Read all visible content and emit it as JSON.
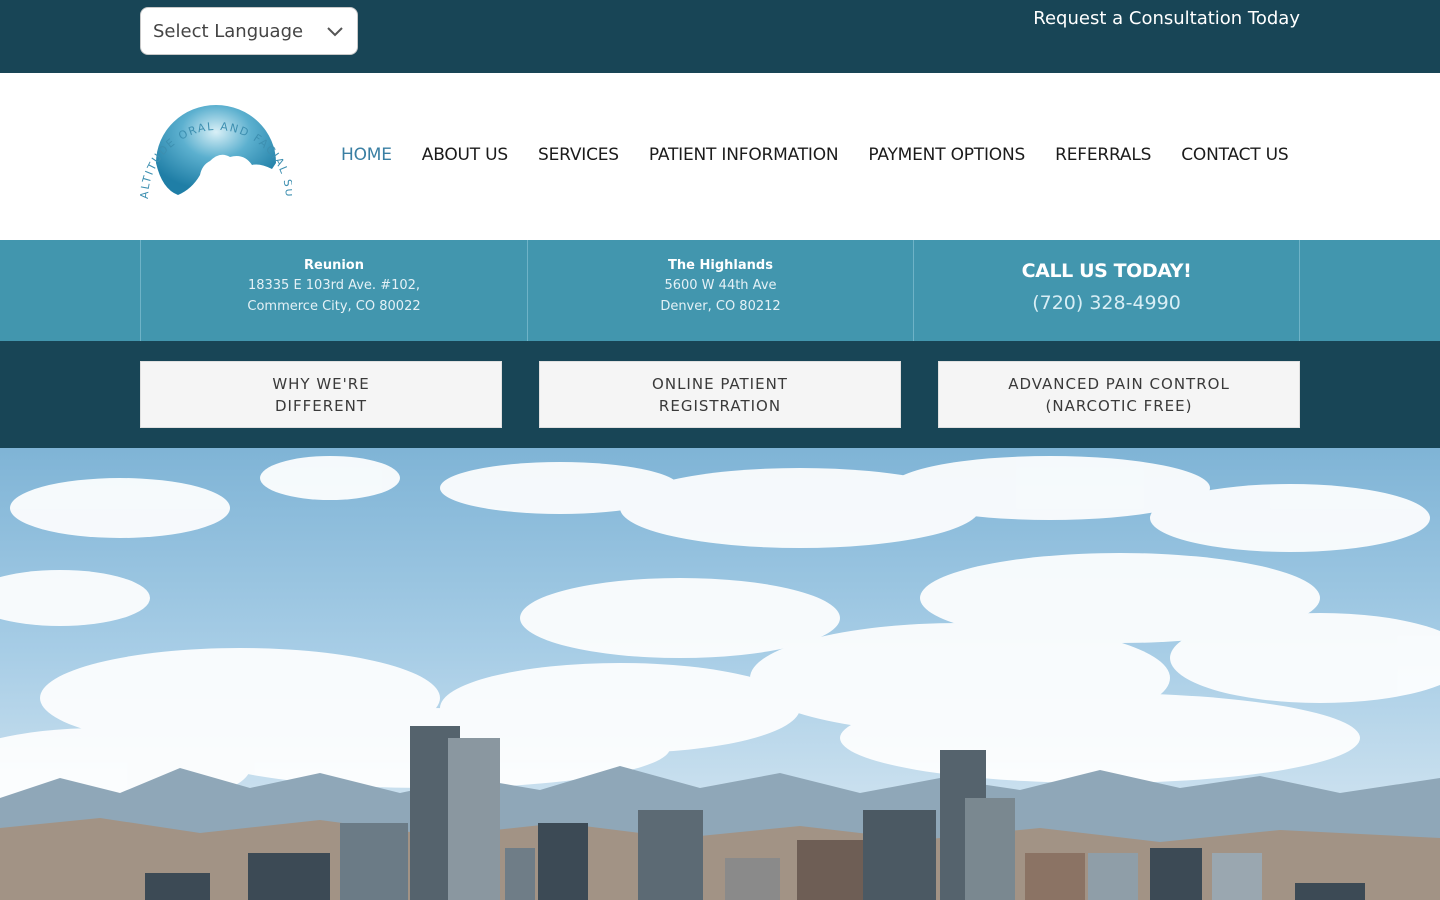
{
  "topbar": {
    "language_select": "Select Language",
    "consultation_link": "Request a Consultation Today"
  },
  "header": {
    "logo_text": "ALTITUDE ORAL AND FACIAL SURGERY",
    "nav": [
      "HOME",
      "ABOUT US",
      "SERVICES",
      "PATIENT INFORMATION",
      "PAYMENT OPTIONS",
      "REFERRALS",
      "CONTACT US"
    ],
    "active_nav": "HOME"
  },
  "locations": [
    {
      "name": "Reunion",
      "line1": "18335 E 103rd Ave. #102,",
      "line2": "Commerce City, CO 80022"
    },
    {
      "name": "The Highlands",
      "line1": "5600 W 44th Ave",
      "line2": "Denver, CO 80212"
    }
  ],
  "call": {
    "title": "CALL US TODAY!",
    "phone": "(720) 328-4990"
  },
  "cta_buttons": [
    "WHY WE'RE\nDIFFERENT",
    "ONLINE PATIENT\nREGISTRATION",
    "ADVANCED PAIN CONTROL\n(NARCOTIC FREE)"
  ],
  "colors": {
    "dark_teal": "#184556",
    "mid_teal": "#4296ae",
    "nav_active": "#3a7fa3"
  },
  "icons": {
    "dropdown": "chevron-down-icon"
  }
}
